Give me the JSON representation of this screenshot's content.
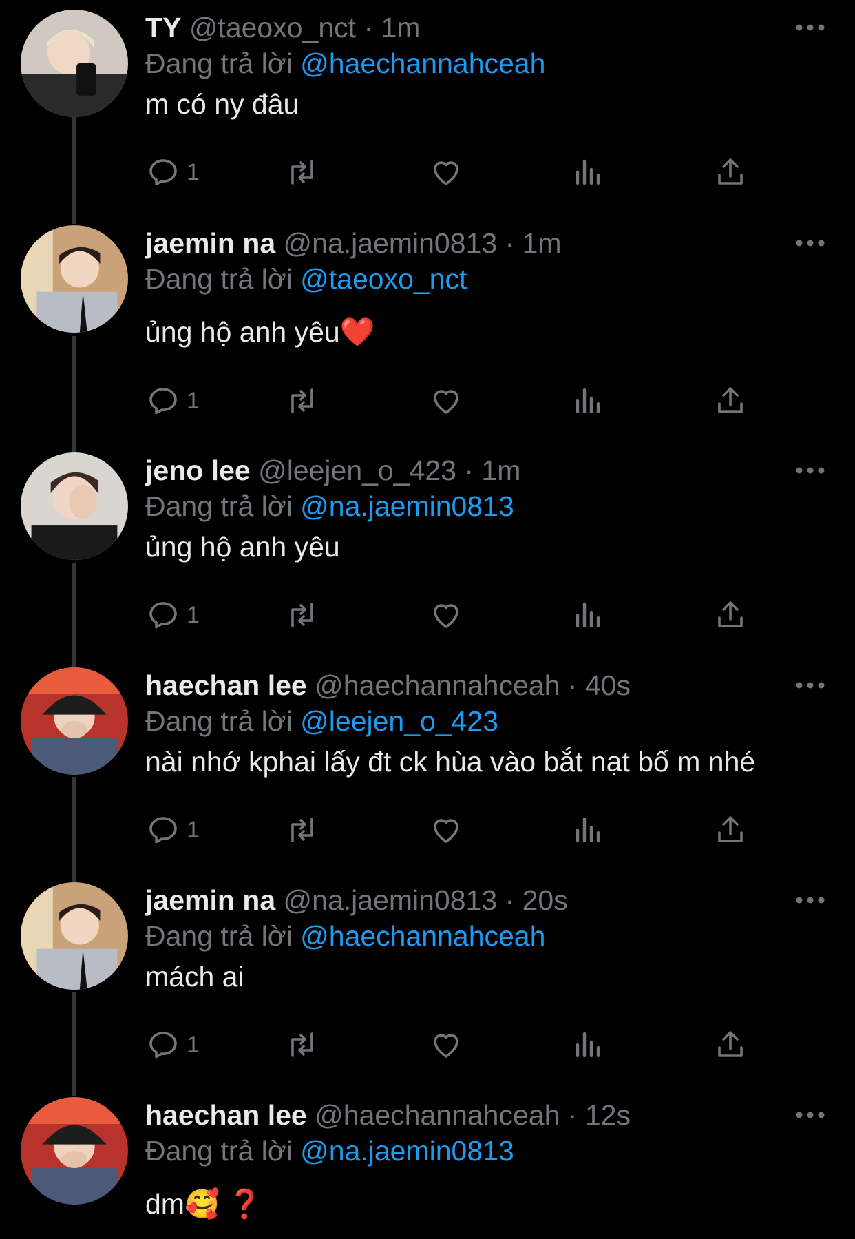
{
  "colors": {
    "background": "#000000",
    "name": "#e7e9ea",
    "muted": "#71767b",
    "mention": "#1d9bf0"
  },
  "tweets": [
    {
      "name": "TY",
      "handle": "@taeoxo_nct",
      "time": "1m",
      "replying_label": "Đang trả lời",
      "reply_to": "@haechannahceah",
      "text": "m có ny đâu",
      "reply_count": "1",
      "avatar": "avatar-ty"
    },
    {
      "name": "jaemin na",
      "handle": "@na.jaemin0813",
      "time": "1m",
      "replying_label": "Đang trả lời",
      "reply_to": "@taeoxo_nct",
      "text": "ủng hộ anh yêu❤️",
      "reply_count": "1",
      "avatar": "avatar-jaemin"
    },
    {
      "name": "jeno lee",
      "handle": "@leejen_o_423",
      "time": "1m",
      "replying_label": "Đang trả lời",
      "reply_to": "@na.jaemin0813",
      "text": "ủng hộ anh yêu",
      "reply_count": "1",
      "avatar": "avatar-jeno"
    },
    {
      "name": "haechan lee",
      "handle": "@haechannahceah",
      "time": "40s",
      "replying_label": "Đang trả lời",
      "reply_to": "@leejen_o_423",
      "text": "nài nhớ kphai lấy đt ck hùa vào bắt nạt bố m nhé",
      "reply_count": "1",
      "avatar": "avatar-haechan"
    },
    {
      "name": "jaemin na",
      "handle": "@na.jaemin0813",
      "time": "20s",
      "replying_label": "Đang trả lời",
      "reply_to": "@haechannahceah",
      "text": "mách ai",
      "reply_count": "1",
      "avatar": "avatar-jaemin"
    },
    {
      "name": "haechan lee",
      "handle": "@haechannahceah",
      "time": "12s",
      "replying_label": "Đang trả lời",
      "reply_to": "@na.jaemin0813",
      "text": "dm🥰 ❓",
      "reply_count": "",
      "avatar": "avatar-haechan"
    }
  ],
  "icons": {
    "reply": "reply-icon",
    "retweet": "retweet-icon",
    "like": "like-icon",
    "views": "views-icon",
    "share": "share-icon",
    "more": "more-icon"
  }
}
